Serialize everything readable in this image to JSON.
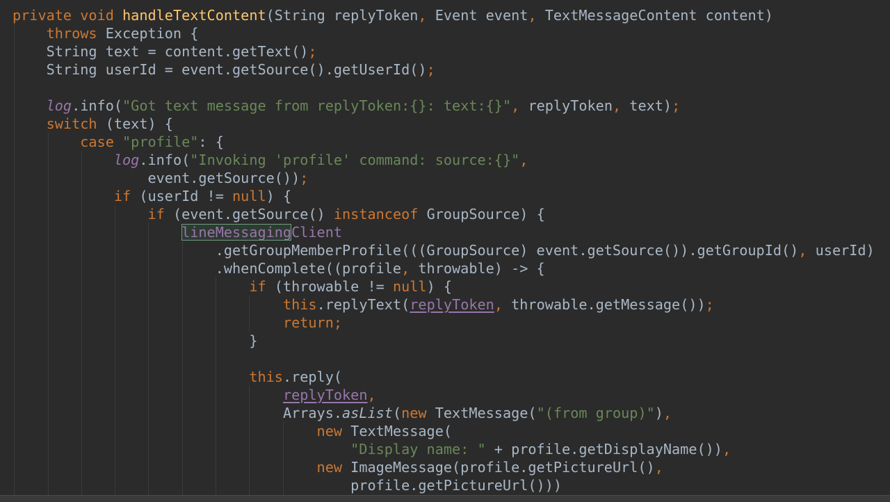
{
  "colors": {
    "background": "#2b2b2b",
    "default": "#a9b7c6",
    "keyword": "#cc7832",
    "function": "#ffc66d",
    "string": "#6a8759",
    "field": "#9876aa"
  },
  "code": {
    "lines": [
      [
        {
          "t": "private void ",
          "c": "kw"
        },
        {
          "t": "handleTextContent",
          "c": "fn"
        },
        {
          "t": "(String replyToken",
          "c": "default"
        },
        {
          "t": ", ",
          "c": "kw"
        },
        {
          "t": "Event event",
          "c": "default"
        },
        {
          "t": ", ",
          "c": "kw"
        },
        {
          "t": "TextMessageContent content)",
          "c": "default"
        }
      ],
      [
        {
          "t": "    "
        },
        {
          "t": "throws ",
          "c": "kw"
        },
        {
          "t": "Exception {",
          "c": "default"
        }
      ],
      [
        {
          "t": "    "
        },
        {
          "t": "String text = content.getText()",
          "c": "default"
        },
        {
          "t": ";",
          "c": "kw"
        }
      ],
      [
        {
          "t": "    "
        },
        {
          "t": "String userId = event.getSource().getUserId()",
          "c": "default"
        },
        {
          "t": ";",
          "c": "kw"
        }
      ],
      [],
      [
        {
          "t": "    "
        },
        {
          "t": "log",
          "c": "field",
          "i": true
        },
        {
          "t": ".info(",
          "c": "default"
        },
        {
          "t": "\"Got text message from replyToken:{}: text:{}\"",
          "c": "str"
        },
        {
          "t": ", ",
          "c": "kw"
        },
        {
          "t": "replyToken",
          "c": "default"
        },
        {
          "t": ", ",
          "c": "kw"
        },
        {
          "t": "text)",
          "c": "default"
        },
        {
          "t": ";",
          "c": "kw"
        }
      ],
      [
        {
          "t": "    "
        },
        {
          "t": "switch ",
          "c": "kw"
        },
        {
          "t": "(text) {",
          "c": "default"
        }
      ],
      [
        {
          "t": "        "
        },
        {
          "t": "case ",
          "c": "kw"
        },
        {
          "t": "\"profile\"",
          "c": "str"
        },
        {
          "t": ": {",
          "c": "default"
        }
      ],
      [
        {
          "t": "            "
        },
        {
          "t": "log",
          "c": "field",
          "i": true
        },
        {
          "t": ".info(",
          "c": "default"
        },
        {
          "t": "\"Invoking 'profile' command: source:{}\"",
          "c": "str"
        },
        {
          "t": ",",
          "c": "kw"
        }
      ],
      [
        {
          "t": "                "
        },
        {
          "t": "event.getSource())",
          "c": "default"
        },
        {
          "t": ";",
          "c": "kw"
        }
      ],
      [
        {
          "t": "            "
        },
        {
          "t": "if ",
          "c": "kw"
        },
        {
          "t": "(userId != ",
          "c": "default"
        },
        {
          "t": "null",
          "c": "kw"
        },
        {
          "t": ") {",
          "c": "default"
        }
      ],
      [
        {
          "t": "                "
        },
        {
          "t": "if ",
          "c": "kw"
        },
        {
          "t": "(event.getSource() ",
          "c": "default"
        },
        {
          "t": "instanceof ",
          "c": "kw"
        },
        {
          "t": "GroupSource) {",
          "c": "default"
        }
      ],
      [
        {
          "t": "                    "
        },
        {
          "t": "lineMessaging",
          "c": "field",
          "b": true
        },
        {
          "t": "Client",
          "c": "field"
        }
      ],
      [
        {
          "t": "                        "
        },
        {
          "t": ".getGroupMemberProfile(((GroupSource) event.getSource()).getGroupId()",
          "c": "default"
        },
        {
          "t": ", ",
          "c": "kw"
        },
        {
          "t": "userId)",
          "c": "default"
        }
      ],
      [
        {
          "t": "                        "
        },
        {
          "t": ".whenComplete((profile",
          "c": "default"
        },
        {
          "t": ", ",
          "c": "kw"
        },
        {
          "t": "throwable) -> {",
          "c": "default"
        }
      ],
      [
        {
          "t": "                            "
        },
        {
          "t": "if ",
          "c": "kw"
        },
        {
          "t": "(throwable != ",
          "c": "default"
        },
        {
          "t": "null",
          "c": "kw"
        },
        {
          "t": ") {",
          "c": "default"
        }
      ],
      [
        {
          "t": "                                "
        },
        {
          "t": "this",
          "c": "kw"
        },
        {
          "t": ".replyText(",
          "c": "default"
        },
        {
          "t": "replyToken",
          "c": "field",
          "u": true
        },
        {
          "t": ", ",
          "c": "kw"
        },
        {
          "t": "throwable.getMessage())",
          "c": "default"
        },
        {
          "t": ";",
          "c": "kw"
        }
      ],
      [
        {
          "t": "                                "
        },
        {
          "t": "return;",
          "c": "kw"
        }
      ],
      [
        {
          "t": "                            "
        },
        {
          "t": "}",
          "c": "default"
        }
      ],
      [],
      [
        {
          "t": "                            "
        },
        {
          "t": "this",
          "c": "kw"
        },
        {
          "t": ".reply(",
          "c": "default"
        }
      ],
      [
        {
          "t": "                                "
        },
        {
          "t": "replyToken",
          "c": "field",
          "u": true
        },
        {
          "t": ",",
          "c": "kw"
        }
      ],
      [
        {
          "t": "                                "
        },
        {
          "t": "Arrays.",
          "c": "default"
        },
        {
          "t": "asList",
          "c": "default",
          "i": true
        },
        {
          "t": "(",
          "c": "default"
        },
        {
          "t": "new ",
          "c": "kw"
        },
        {
          "t": "TextMessage(",
          "c": "default"
        },
        {
          "t": "\"(from group)\"",
          "c": "str"
        },
        {
          "t": ")",
          "c": "default"
        },
        {
          "t": ",",
          "c": "kw"
        }
      ],
      [
        {
          "t": "                                    "
        },
        {
          "t": "new ",
          "c": "kw"
        },
        {
          "t": "TextMessage(",
          "c": "default"
        }
      ],
      [
        {
          "t": "                                        "
        },
        {
          "t": "\"Display name: \" ",
          "c": "str"
        },
        {
          "t": "+ profile.getDisplayName())",
          "c": "default"
        },
        {
          "t": ",",
          "c": "kw"
        }
      ],
      [
        {
          "t": "                                    "
        },
        {
          "t": "new ",
          "c": "kw"
        },
        {
          "t": "ImageMessage(profile.getPictureUrl()",
          "c": "default"
        },
        {
          "t": ",",
          "c": "kw"
        }
      ],
      [
        {
          "t": "                                        "
        },
        {
          "t": "profile.getPictureUrl()))",
          "c": "default"
        }
      ]
    ]
  }
}
